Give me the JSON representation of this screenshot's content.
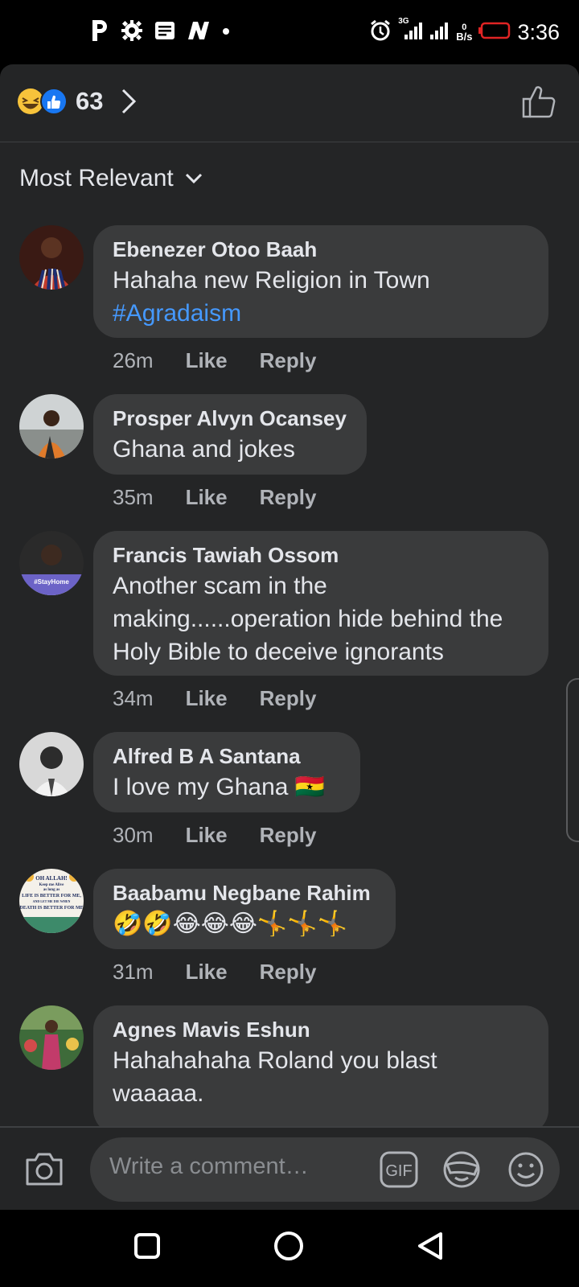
{
  "status_bar": {
    "time": "3:36",
    "net_speed_value": "0",
    "net_speed_unit": "B/s",
    "network": "3G",
    "icons": [
      "p-app-icon",
      "settings-icon",
      "news-icon",
      "n-app-icon",
      "dot-icon",
      "alarm-icon",
      "signal-icon",
      "signal-icon",
      "battery-low-icon"
    ]
  },
  "reactions": {
    "count": "63",
    "icons": [
      "laughing-emoji-icon",
      "like-reaction-icon"
    ]
  },
  "sort": {
    "label": "Most Relevant"
  },
  "comments": [
    {
      "name": "Ebenezer Otoo Baah",
      "text": "Hahaha new Religion in Town",
      "hashtag": "#Agradaism",
      "time": "26m",
      "like": "Like",
      "reply": "Reply"
    },
    {
      "name": "Prosper Alvyn Ocansey",
      "text": "Ghana and jokes",
      "time": "35m",
      "like": "Like",
      "reply": "Reply"
    },
    {
      "name": "Francis Tawiah Ossom",
      "text_lines": [
        "Another scam in the",
        "making......operation hide behind the",
        "Holy Bible to deceive ignorants"
      ],
      "time": "34m",
      "like": "Like",
      "reply": "Reply",
      "avatar_badge": "#StayHome"
    },
    {
      "name": "Alfred B A Santana",
      "text": "I love my Ghana 🇬🇭",
      "time": "30m",
      "like": "Like",
      "reply": "Reply"
    },
    {
      "name": "Baabamu Negbane Rahim",
      "text": "🤣🤣😂😂😂🤸🤸🤸",
      "time": "31m",
      "like": "Like",
      "reply": "Reply",
      "avatar_text": [
        "OH ALLAH!",
        "Keep me Alive",
        "as long as",
        "LIFE IS BETTER FOR ME,",
        "AND LET ME DIE WHEN",
        "DEATH IS BETTER FOR ME"
      ]
    },
    {
      "name": "Agnes Mavis Eshun",
      "text_lines": [
        "Hahahahaha Roland you blast",
        "waaaaa."
      ]
    }
  ],
  "composer": {
    "placeholder": "Write a comment…",
    "gif_label": "GIF",
    "icons": [
      "camera-icon",
      "gif-icon",
      "sticker-icon",
      "emoji-icon"
    ]
  },
  "navbar": {
    "icons": [
      "recents-square-icon",
      "home-circle-icon",
      "back-triangle-icon"
    ]
  },
  "colors": {
    "background": "#242526",
    "bubble": "#3a3b3c",
    "hashtag": "#4599ff",
    "like_blue": "#1877f2",
    "battery_red": "#e02424"
  }
}
